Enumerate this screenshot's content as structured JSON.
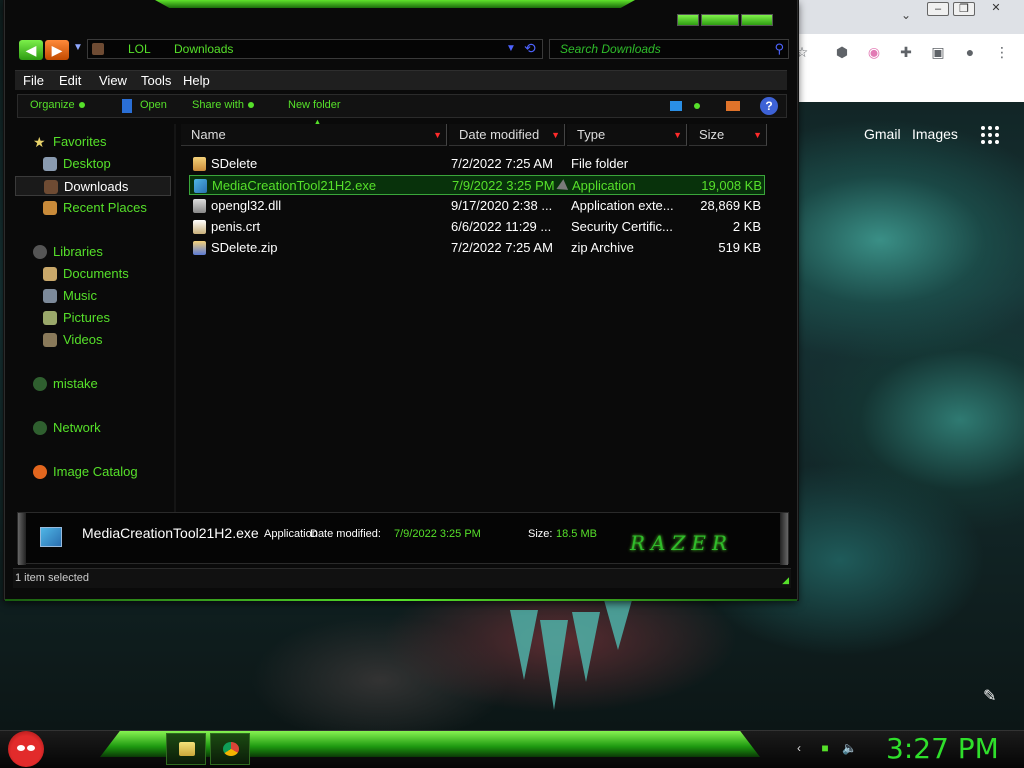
{
  "explorer": {
    "address": {
      "crumbs": [
        "LOL",
        "Downloads"
      ]
    },
    "search_placeholder": "Search Downloads",
    "menu": [
      "File",
      "Edit",
      "View",
      "Tools",
      "Help"
    ],
    "commands": {
      "organize": "Organize",
      "open": "Open",
      "share_with": "Share with",
      "new_folder": "New folder"
    },
    "nav_pane": [
      {
        "label": "Favorites",
        "icon": "star-icon"
      },
      {
        "label": "Desktop",
        "icon": "desktop-icon"
      },
      {
        "label": "Downloads",
        "icon": "downloads-icon",
        "selected": true
      },
      {
        "label": "Recent Places",
        "icon": "recent-places-icon"
      },
      {
        "label": "Libraries",
        "icon": "libraries-icon"
      },
      {
        "label": "Documents",
        "icon": "documents-icon"
      },
      {
        "label": "Music",
        "icon": "music-icon"
      },
      {
        "label": "Pictures",
        "icon": "pictures-icon"
      },
      {
        "label": "Videos",
        "icon": "videos-icon"
      },
      {
        "label": "mistake",
        "icon": "homegroup-icon"
      },
      {
        "label": "Network",
        "icon": "network-icon"
      },
      {
        "label": "Image Catalog",
        "icon": "image-catalog-icon"
      }
    ],
    "columns": [
      "Name",
      "Date modified",
      "Type",
      "Size"
    ],
    "files": [
      {
        "name": "SDelete",
        "date": "7/2/2022 7:25 AM",
        "type": "File folder",
        "size": "",
        "icon": "folder-icon"
      },
      {
        "name": "MediaCreationTool21H2.exe",
        "date": "7/9/2022 3:25 PM",
        "type": "Application",
        "size": "19,008 KB",
        "icon": "exe-icon",
        "selected": true
      },
      {
        "name": "opengl32.dll",
        "date": "9/17/2020 2:38 ...",
        "type": "Application exte...",
        "size": "28,869 KB",
        "icon": "dll-icon"
      },
      {
        "name": "penis.crt",
        "date": "6/6/2022 11:29 ...",
        "type": "Security Certific...",
        "size": "2 KB",
        "icon": "certificate-icon"
      },
      {
        "name": "SDelete.zip",
        "date": "7/2/2022 7:25 AM",
        "type": "zip Archive",
        "size": "519 KB",
        "icon": "zip-icon"
      }
    ],
    "details": {
      "name": "MediaCreationTool21H2.exe",
      "type": "Application",
      "date_label": "Date modified:",
      "date_value": "7/9/2022 3:25 PM",
      "size_label": "Size:",
      "size_value": "18.5 MB",
      "logo_text": "RAZER"
    },
    "status": "1 item selected"
  },
  "browser": {
    "gmail": "Gmail",
    "images": "Images"
  },
  "taskbar": {
    "clock": "3:27 PM",
    "apps": [
      "explorer-icon",
      "chrome-icon"
    ]
  },
  "colors": {
    "accent_green": "#56e02a",
    "selection_bg": "#08320b",
    "sort_arrow": "#ff2a2a"
  }
}
